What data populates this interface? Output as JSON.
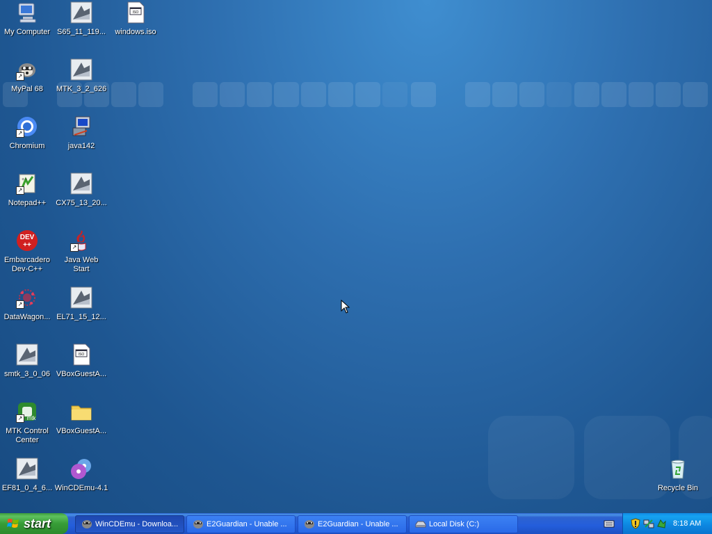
{
  "desktop": {
    "icons": [
      {
        "label": "My Computer",
        "icon": "my-computer-icon"
      },
      {
        "label": "S65_11_119...",
        "icon": "installer-icon"
      },
      {
        "label": "windows.iso",
        "icon": "iso-file-icon"
      },
      {
        "label": "MyPal 68",
        "icon": "mypal-browser-icon"
      },
      {
        "label": "MTK_3_2_626",
        "icon": "installer-icon"
      },
      {
        "label": "Chromium",
        "icon": "chromium-icon"
      },
      {
        "label": "java142",
        "icon": "java-setup-icon"
      },
      {
        "label": "Notepad++",
        "icon": "notepad-plus-plus-icon"
      },
      {
        "label": "CX75_13_20...",
        "icon": "installer-icon"
      },
      {
        "label": "Embarcadero\nDev-C++",
        "icon": "dev-cpp-icon"
      },
      {
        "label": "Java Web\nStart",
        "icon": "java-web-start-icon"
      },
      {
        "label": "DataWagon...",
        "icon": "datawagon-icon"
      },
      {
        "label": "EL71_15_12...",
        "icon": "installer-icon"
      },
      {
        "label": "smtk_3_0_06",
        "icon": "installer-icon"
      },
      {
        "label": "VBoxGuestA...",
        "icon": "iso-file-icon"
      },
      {
        "label": "MTK Control\nCenter",
        "icon": "mtk-control-center-icon"
      },
      {
        "label": "VBoxGuestA...",
        "icon": "folder-icon"
      },
      {
        "label": "EF81_0_4_6...",
        "icon": "installer-icon"
      },
      {
        "label": "WinCDEmu-4.1",
        "icon": "wincdemu-icon"
      },
      {
        "label": "Recycle Bin",
        "icon": "recycle-bin-icon"
      }
    ]
  },
  "taskbar": {
    "start_label": "start",
    "tasks": [
      {
        "label": "WinCDEmu - Downloa...",
        "icon": "browser-icon",
        "active": true
      },
      {
        "label": "E2Guardian - Unable ...",
        "icon": "browser-icon",
        "active": false
      },
      {
        "label": "E2Guardian - Unable ...",
        "icon": "browser-icon",
        "active": false
      },
      {
        "label": "Local Disk (C:)",
        "icon": "drive-icon",
        "active": false
      }
    ],
    "tray": {
      "icons": [
        "keyboard-icon",
        "security-shield-icon",
        "network-icon",
        "update-icon"
      ],
      "clock": "8:18 AM"
    }
  },
  "colors": {
    "desktop_blue": "#1e5691",
    "taskbar_blue": "#245edb",
    "start_green": "#379d37",
    "tray_blue": "#0c86e0"
  }
}
